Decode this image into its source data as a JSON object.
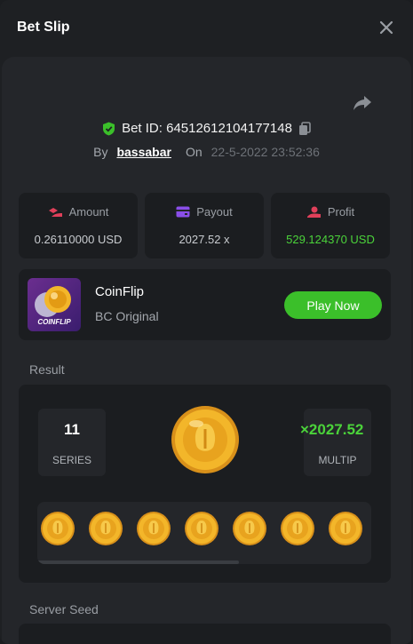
{
  "header": {
    "title": "Bet Slip"
  },
  "bet": {
    "id_label": "Bet ID: 64512612104177148",
    "by_label": "By",
    "user": "bassabar",
    "on_label": "On",
    "date": "22-5-2022 23:52:36"
  },
  "stats": [
    {
      "label": "Amount",
      "value": "0.26110000 USD",
      "icon": "amount-icon",
      "color": "#e0405a"
    },
    {
      "label": "Payout",
      "value": "2027.52 x",
      "icon": "wallet-icon",
      "color": "#8a4ee8"
    },
    {
      "label": "Profit",
      "value": "529.124370 USD",
      "icon": "profit-icon",
      "color": "#e0405a",
      "value_color": "#4bd33a"
    }
  ],
  "game": {
    "thumb_label": "COINFLIP",
    "name": "CoinFlip",
    "subtitle": "BC Original",
    "play_label": "Play Now"
  },
  "result": {
    "label": "Result",
    "series_value": "11",
    "series_caption": "SERIES",
    "multiplier_value": "×2027.52",
    "multiplier_caption": "MULTIP",
    "coins_visible": 7
  },
  "server_seed": {
    "label": "Server Seed"
  },
  "colors": {
    "accent_green": "#3bbf2a",
    "coin_gold": "#f3b62a"
  }
}
